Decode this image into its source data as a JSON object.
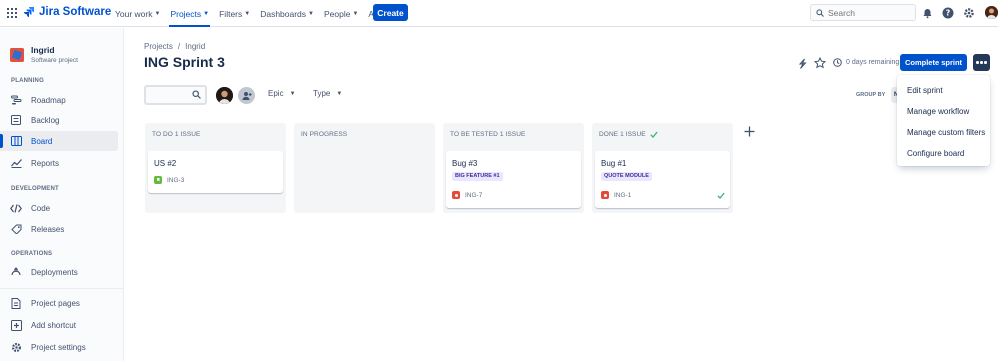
{
  "topnav": {
    "logo": "Jira Software",
    "items": [
      {
        "label": "Your work",
        "active": false
      },
      {
        "label": "Projects",
        "active": true
      },
      {
        "label": "Filters",
        "active": false
      },
      {
        "label": "Dashboards",
        "active": false
      },
      {
        "label": "People",
        "active": false
      },
      {
        "label": "Apps",
        "active": false
      }
    ],
    "create_label": "Create",
    "search_placeholder": "Search",
    "accent": "#0052CC"
  },
  "sidebar": {
    "project_name": "Ingrid",
    "project_type": "Software project",
    "sections": {
      "planning": "PLANNING",
      "development": "DEVELOPMENT",
      "operations": "OPERATIONS"
    },
    "planning_items": [
      {
        "label": "Roadmap",
        "icon": "roadmap-icon"
      },
      {
        "label": "Backlog",
        "icon": "backlog-icon"
      },
      {
        "label": "Board",
        "icon": "board-icon",
        "active": true
      },
      {
        "label": "Reports",
        "icon": "reports-icon"
      }
    ],
    "development_items": [
      {
        "label": "Code",
        "icon": "code-icon"
      },
      {
        "label": "Releases",
        "icon": "releases-icon"
      }
    ],
    "operations_items": [
      {
        "label": "Deployments",
        "icon": "deployments-icon"
      }
    ],
    "bottom_items": [
      {
        "label": "Project pages",
        "icon": "pages-icon"
      },
      {
        "label": "Add shortcut",
        "icon": "add-shortcut-icon"
      },
      {
        "label": "Project settings",
        "icon": "settings-icon"
      }
    ]
  },
  "main": {
    "breadcrumb": [
      "Projects",
      "/",
      "Ingrid"
    ],
    "title": "ING Sprint 3",
    "remaining": "0 days remaining",
    "complete_label": "Complete sprint",
    "filters": {
      "epic": "Epic",
      "type": "Type"
    },
    "group_by": "GROUP BY",
    "group_value": "N"
  },
  "menu": [
    "Edit sprint",
    "Manage workflow",
    "Manage custom filters",
    "Configure board"
  ],
  "columns": [
    {
      "title": "TO DO 1 ISSUE",
      "cards": [
        {
          "title": "US #2",
          "epic": "",
          "key": "ING-3",
          "type": "story",
          "done": false
        }
      ]
    },
    {
      "title": "IN PROGRESS",
      "cards": []
    },
    {
      "title": "TO BE TESTED 1 ISSUE",
      "cards": [
        {
          "title": "Bug #3",
          "epic": "BIG FEATURE #1",
          "key": "ING-7",
          "type": "bug",
          "done": false
        }
      ]
    },
    {
      "title": "DONE 1 ISSUE",
      "done_check": true,
      "cards": [
        {
          "title": "Bug #1",
          "epic": "QUOTE MODULE",
          "key": "ING-1",
          "type": "bug",
          "done": true
        }
      ]
    }
  ]
}
